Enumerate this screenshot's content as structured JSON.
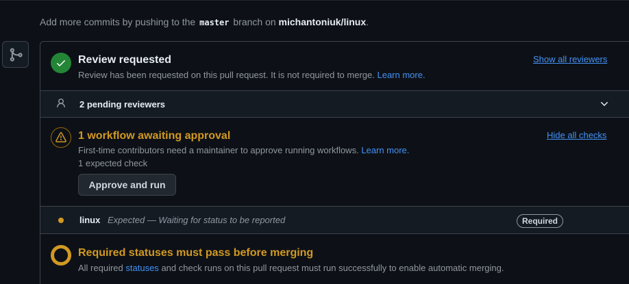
{
  "push_note": {
    "prefix": "Add more commits by pushing to the",
    "branch": "master",
    "middle": "branch on",
    "repo": "michantoniuk/linux",
    "suffix": "."
  },
  "review": {
    "title": "Review requested",
    "description": "Review has been requested on this pull request. It is not required to merge.",
    "learn_more": "Learn more.",
    "show_all": "Show all reviewers",
    "status_color": "#238636"
  },
  "pending": {
    "label": "2 pending reviewers"
  },
  "workflow": {
    "title": "1 workflow awaiting approval",
    "description": "First-time contributors need a maintainer to approve running workflows.",
    "learn_more": "Learn more.",
    "expected": "1 expected check",
    "approve_button": "Approve and run",
    "hide_checks": "Hide all checks",
    "accent_color": "#d29922"
  },
  "check": {
    "name": "linux",
    "status": "Expected — Waiting for status to be reported",
    "badge": "Required"
  },
  "required_statuses": {
    "title": "Required statuses must pass before merging",
    "prefix": "All required",
    "statuses_link": "statuses",
    "suffix": "and check runs on this pull request must run successfully to enable automatic merging.",
    "accent_color": "#d29922"
  },
  "icons": {
    "timeline": "git-merge-icon",
    "review": "check-icon",
    "pending": "person-icon",
    "expand": "chevron-down-icon",
    "workflow": "alert-icon",
    "check": "dot-fill-icon",
    "required": "circle-ring-icon"
  }
}
